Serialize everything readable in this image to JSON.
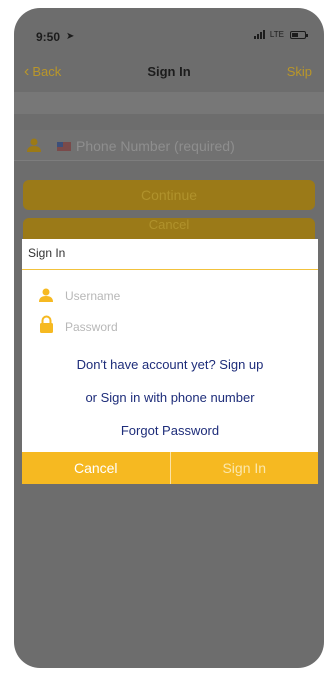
{
  "status_bar": {
    "time": "9:50",
    "carrier": "LTE"
  },
  "nav": {
    "back_label": "Back",
    "title": "Sign In",
    "skip_label": "Skip"
  },
  "phone_field": {
    "placeholder": "Phone Number (required)"
  },
  "background_buttons": {
    "continue_label": "Continue",
    "cancel_label": "Cancel"
  },
  "dialog": {
    "title": "Sign In",
    "username_placeholder": "Username",
    "password_placeholder": "Password",
    "signup_link": "Don't have account yet? Sign up",
    "phone_signin_link": "or Sign in with phone number",
    "forgot_link": "Forgot Password",
    "cancel_label": "Cancel",
    "signin_label": "Sign In"
  },
  "colors": {
    "accent": "#f6b921",
    "link": "#1e2d7a",
    "overlay": "#6d6d6d"
  }
}
